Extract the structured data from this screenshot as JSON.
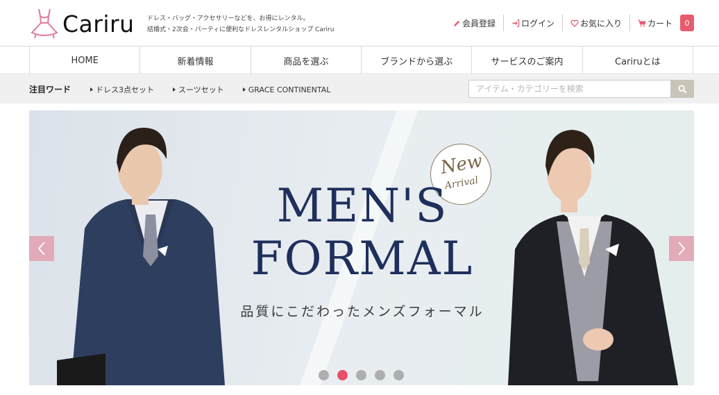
{
  "header": {
    "logo_text": "Cariru",
    "tagline_line1": "ドレス・バッグ・アクセサリーなどを、お得にレンタル。",
    "tagline_line2": "結婚式・2次会・パーティに便利なドレスレンタルショップ Cariru",
    "links": {
      "register": "会員登録",
      "login": "ログイン",
      "favorites": "お気に入り",
      "cart": "カート",
      "cart_count": "0"
    }
  },
  "nav": {
    "items": [
      "HOME",
      "新着情報",
      "商品を選ぶ",
      "ブランドから選ぶ",
      "サービスのご案内",
      "Cariruとは"
    ]
  },
  "keywords": {
    "title": "注目ワード",
    "items": [
      "ドレス3点セット",
      "スーツセット",
      "GRACE CONTINENTAL"
    ]
  },
  "search": {
    "placeholder": "アイテム・カテゴリーを検索"
  },
  "banner": {
    "headline_line1": "MEN'S",
    "headline_line2": "FORMAL",
    "subtitle": "品質にこだわったメンズフォーマル",
    "badge_new": "New",
    "badge_arrival": "Arrival",
    "slide_count": 5,
    "active_slide": 2
  },
  "colors": {
    "accent_pink": "#e8506a",
    "arrow_pink": "#e3a7b6",
    "headline_navy": "#1f2f5c",
    "badge_gold": "#7a6546"
  },
  "icons": {
    "register": "pencil-icon",
    "login": "sign-in-icon",
    "favorites": "heart-icon",
    "cart": "cart-icon",
    "search": "search-icon",
    "prev": "chevron-left-icon",
    "next": "chevron-right-icon"
  }
}
